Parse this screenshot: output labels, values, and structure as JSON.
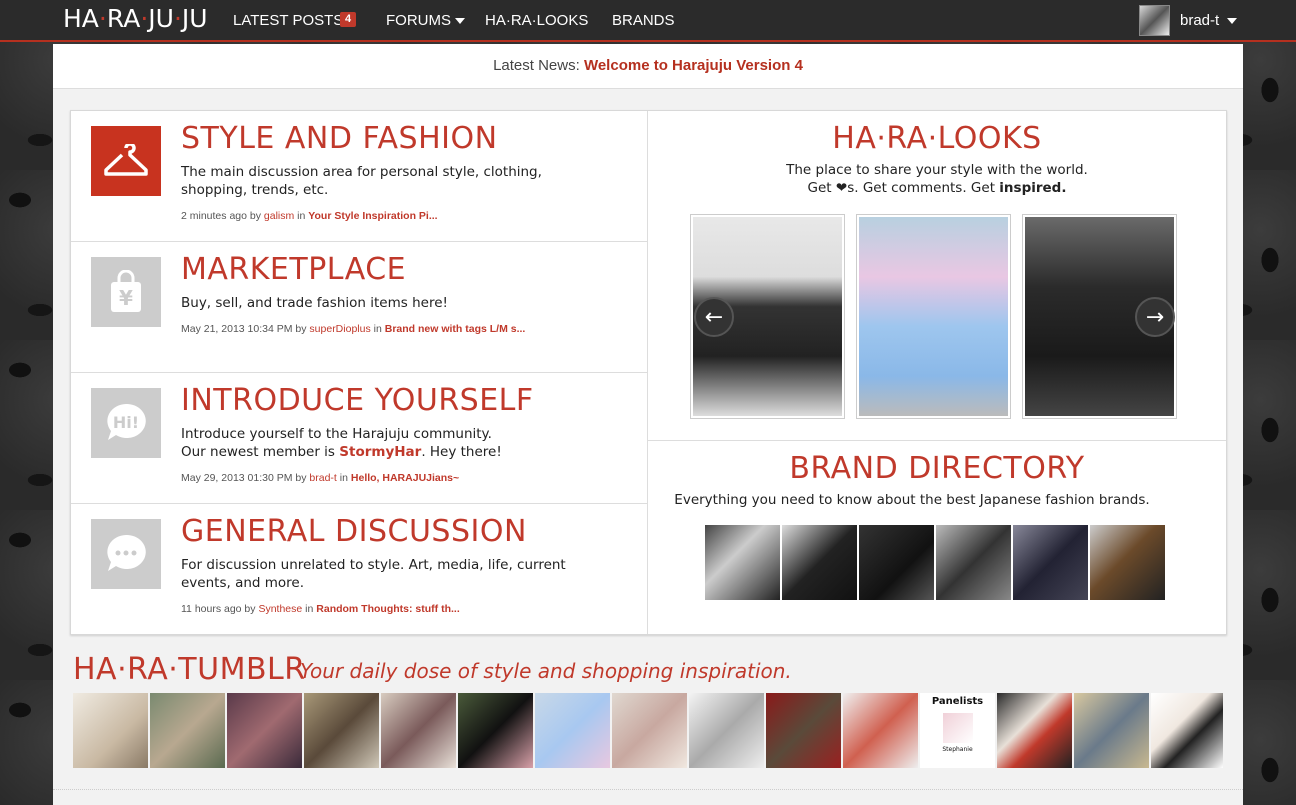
{
  "nav": {
    "logo_parts": [
      "HA",
      "RA",
      "JU",
      "JU"
    ],
    "latest_posts": "LATEST POSTS",
    "latest_posts_count": "4",
    "forums": "FORUMS",
    "haralooks": "HA·RA·LOOKS",
    "brands": "BRANDS",
    "user": "brad-t"
  },
  "news": {
    "label": "Latest News:",
    "headline": "Welcome to Harajuju Version 4"
  },
  "forums": [
    {
      "title": "STYLE AND FASHION",
      "icon": "hanger-icon",
      "desc": "The main discussion area for personal style, clothing, shopping, trends, etc.",
      "time": "2 minutes ago by",
      "user": "galism",
      "in": "in",
      "thread": "Your Style Inspiration Pi..."
    },
    {
      "title": "MARKETPLACE",
      "icon": "shopping-bag-yen-icon",
      "desc": "Buy, sell, and trade fashion items here!",
      "time": "May 21, 2013 10:34 PM by",
      "user": "superDioplus",
      "in": "in",
      "thread": "Brand new with tags L/M s..."
    },
    {
      "title": "INTRODUCE YOURSELF",
      "icon": "hi-speech-bubble-icon",
      "desc_line1": "Introduce yourself to the Harajuju community.",
      "desc_prefix": "Our newest member is",
      "desc_member": "StormyHar",
      "desc_suffix": ". Hey there!",
      "time": "May 29, 2013 01:30 PM by",
      "user": "brad-t",
      "in": "in",
      "thread": "Hello, HARAJUJians~"
    },
    {
      "title": "GENERAL DISCUSSION",
      "icon": "chat-bubble-icon",
      "desc": "For discussion unrelated to style. Art, media, life, current events, and more.",
      "time": "11 hours ago by",
      "user": "Synthese",
      "in": "in",
      "thread": "Random Thoughts: stuff th..."
    }
  ],
  "haralooks": {
    "title": "HA·RA·LOOKS",
    "desc_line1": "The place to share your style with the world.",
    "desc_get": "Get",
    "desc_mid": "s. Get comments. Get",
    "desc_bold": "inspired."
  },
  "brand_directory": {
    "title": "BRAND DIRECTORY",
    "desc": "Everything you need to know about the best Japanese fashion brands."
  },
  "tumblr": {
    "title": "HA·RA·TUMBLR",
    "tagline": "Your daily dose of style and shopping inspiration.",
    "panel_text": "Panelists",
    "panel_name": "Stephanie"
  },
  "colors": {
    "accent": "#c0392b",
    "nav_bg": "#2b2b2b"
  }
}
